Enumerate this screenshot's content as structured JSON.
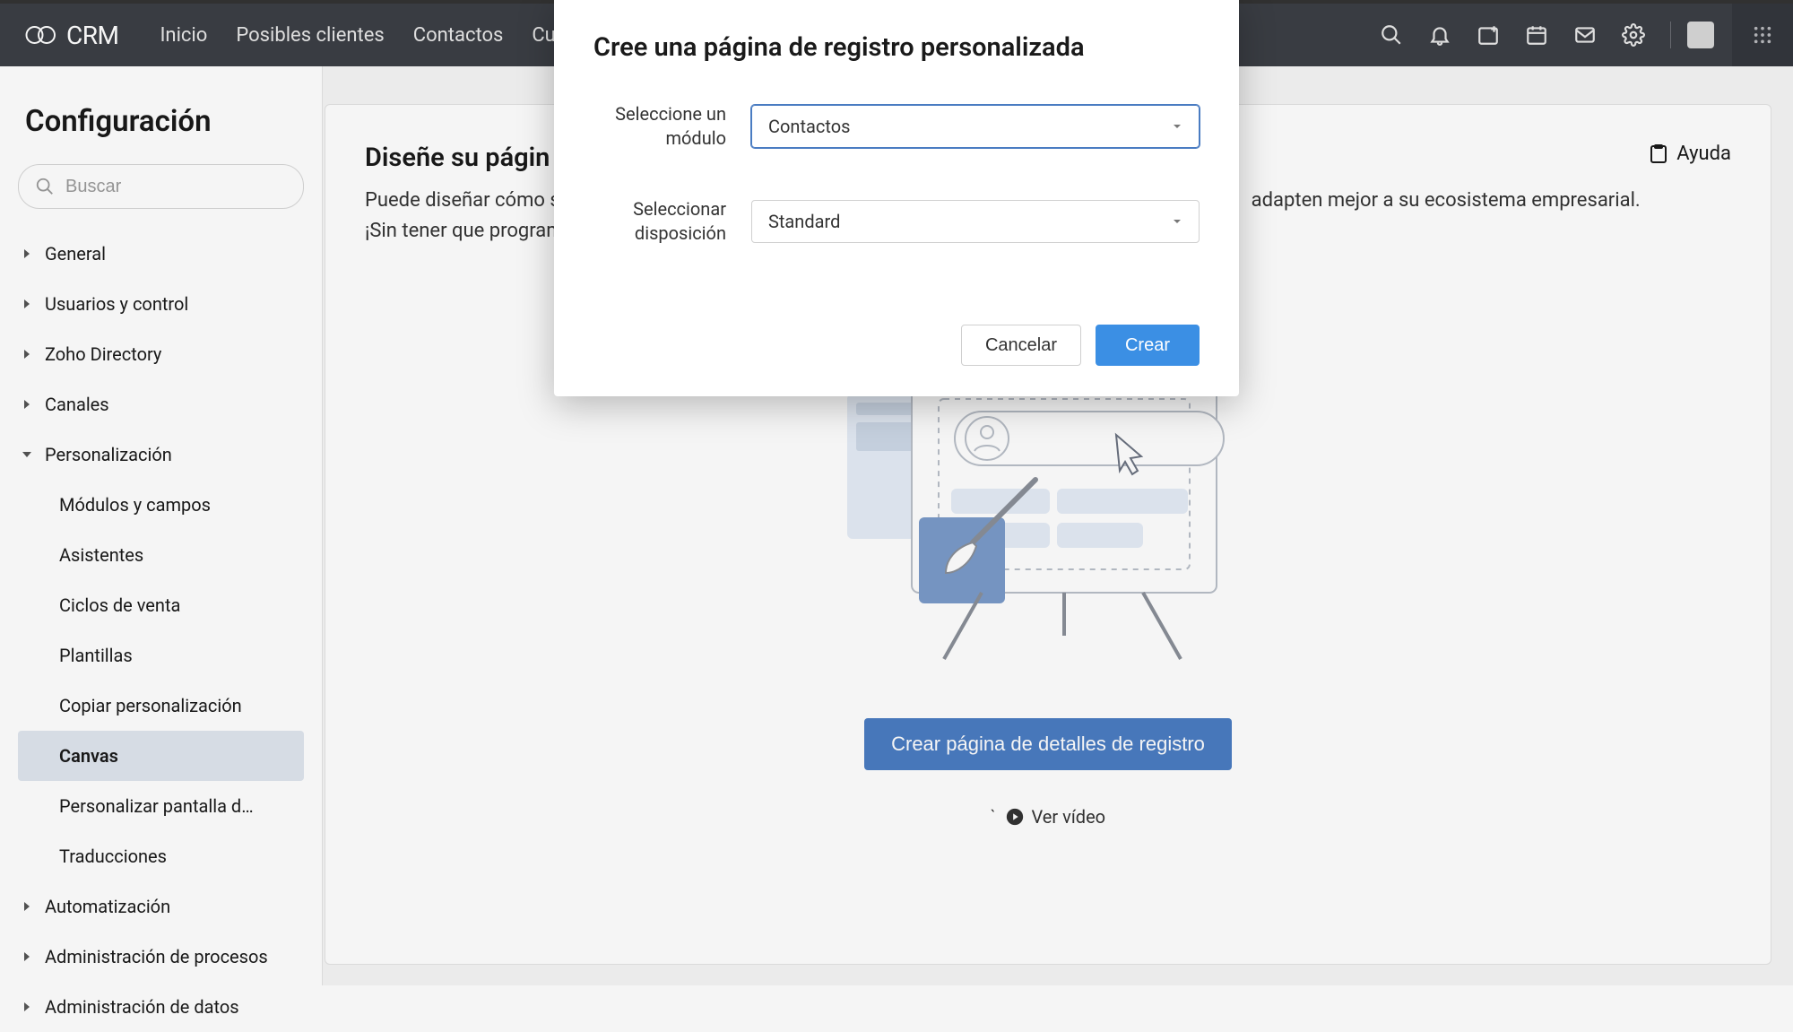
{
  "header": {
    "brand": "CRM",
    "nav": [
      "Inicio",
      "Posibles clientes",
      "Contactos",
      "Cuent"
    ]
  },
  "sidebar": {
    "title": "Configuración",
    "search_placeholder": "Buscar",
    "items": [
      {
        "label": "General",
        "expanded": false
      },
      {
        "label": "Usuarios y control",
        "expanded": false
      },
      {
        "label": "Zoho Directory",
        "expanded": false
      },
      {
        "label": "Canales",
        "expanded": false
      },
      {
        "label": "Personalización",
        "expanded": true,
        "children": [
          "Módulos y campos",
          "Asistentes",
          "Ciclos de venta",
          "Plantillas",
          "Copiar personalización",
          "Canvas",
          "Personalizar pantalla d…",
          "Traducciones"
        ],
        "active_child": "Canvas"
      },
      {
        "label": "Automatización",
        "expanded": false
      },
      {
        "label": "Administración de procesos",
        "expanded": false
      },
      {
        "label": "Administración de datos",
        "expanded": false
      }
    ]
  },
  "main": {
    "title_partial": "Diseñe su págin",
    "description_partial_left": "Puede diseñar cómo s",
    "description_partial_right": "adapten mejor a su ecosistema empresarial. ¡Sin tener que programar!",
    "help_label": "Ayuda",
    "create_button": "Crear página de detalles de registro",
    "video_link": "Ver vídeo"
  },
  "modal": {
    "title": "Cree una página de registro personalizada",
    "field1_label": "Seleccione un módulo",
    "field1_value": "Contactos",
    "field2_label": "Seleccionar disposición",
    "field2_value": "Standard",
    "cancel": "Cancelar",
    "create": "Crear"
  }
}
